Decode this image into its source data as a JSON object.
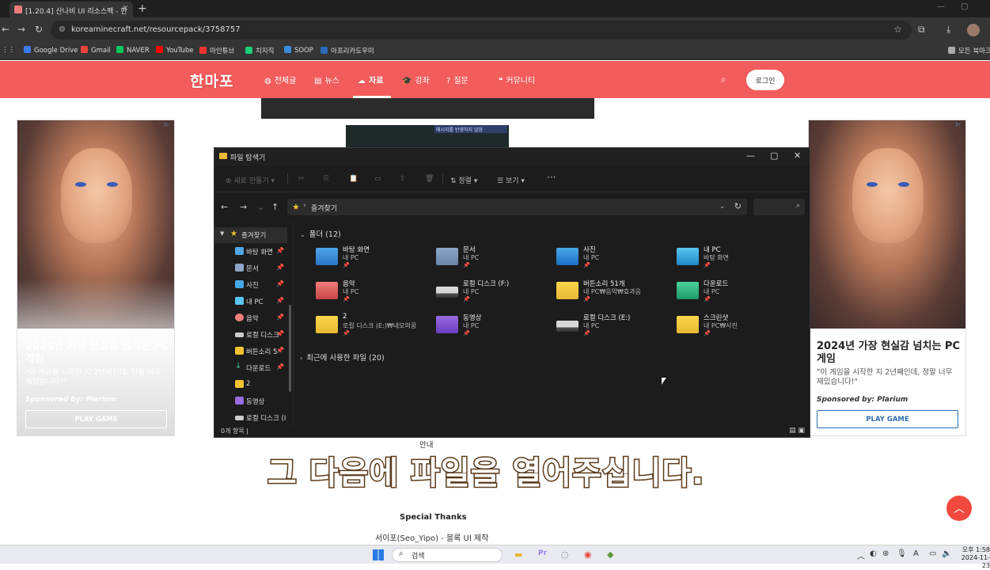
{
  "browser": {
    "tab_title": "[1.20.4] 산나비 UI 리소스팩 - 한",
    "url": "koreaminecraft.net/resourcepack/3758757",
    "bookmarks": [
      "Google Drive",
      "Gmail",
      "NAVER",
      "YouTube",
      "마인튜브",
      "치지직",
      "SOOP",
      "아프리카도우미"
    ],
    "bookmark_colors": [
      "#3b7ced",
      "#e8453c",
      "#03c75a",
      "#ff0000",
      "#e33",
      "#1fcf7a",
      "#3a8dde",
      "#2a6ab8"
    ],
    "all_bookmarks": "모든 북마크"
  },
  "site": {
    "logo": "한마포",
    "nav": [
      {
        "icon": "globe-icon",
        "label": "전체글"
      },
      {
        "icon": "news-icon",
        "label": "뉴스"
      },
      {
        "icon": "cloud-download-icon",
        "label": "자료"
      },
      {
        "icon": "graduation-cap-icon",
        "label": "강좌"
      },
      {
        "icon": "question-icon",
        "label": "질문"
      },
      {
        "icon": "chat-icon",
        "label": "커뮤니티"
      }
    ],
    "login_label": "로그인",
    "accent_color": "#f25c5c"
  },
  "content_tip": "메시지를 반영하지 않음",
  "ad": {
    "title": "2024년 가장 현실감 넘치는 PC 게임",
    "desc": "\"이 게임을 시작한 지 2년째인데, 정말 너무 재밌습니다!\"",
    "sponsor": "Sponsored by: Plarium",
    "button": "PLAY GAME"
  },
  "explorer": {
    "title": "파일 탐색기",
    "toolbar": {
      "new": "새로 만들기",
      "sort": "정렬",
      "view": "보기",
      "more": "···"
    },
    "path": "즐겨찾기",
    "sidebar": [
      {
        "label": "즐겨찾기",
        "color": "#f2c230"
      },
      {
        "label": "바탕 화면",
        "color": "#4fa6e8"
      },
      {
        "label": "문서",
        "color": "#8da6c8"
      },
      {
        "label": "사진",
        "color": "#47a8e8"
      },
      {
        "label": "내 PC",
        "color": "#59c5f0"
      },
      {
        "label": "음악",
        "color": "#f07c7c"
      },
      {
        "label": "로컬 디스크",
        "color": "#ccc"
      },
      {
        "label": "버튼소리 5",
        "color": "#f2c230"
      },
      {
        "label": "다운로드",
        "color": "#4ad09a"
      },
      {
        "label": "2",
        "color": "#f2c230"
      },
      {
        "label": "동영상",
        "color": "#9a6ae0"
      },
      {
        "label": "로컬 디스크 (I",
        "color": "#ccc"
      }
    ],
    "folders_header": "폴더 (12)",
    "recent_header": "최근에 사용한 파일 (20)",
    "folders": [
      {
        "name": "바탕 화면",
        "sub": "내 PC",
        "kind": "folder-blue"
      },
      {
        "name": "문서",
        "sub": "내 PC",
        "kind": "folder-doc"
      },
      {
        "name": "사진",
        "sub": "내 PC",
        "kind": "folder-pic"
      },
      {
        "name": "내 PC",
        "sub": "바탕 화면",
        "kind": "folder-pc"
      },
      {
        "name": "음악",
        "sub": "내 PC",
        "kind": "folder-music"
      },
      {
        "name": "로컬 디스크 (F:)",
        "sub": "내 PC",
        "kind": "drive"
      },
      {
        "name": "버튼소리 51개",
        "sub": "내 PC₩음악₩효과음",
        "kind": "folder-yellow"
      },
      {
        "name": "다운로드",
        "sub": "내 PC",
        "kind": "folder-dl"
      },
      {
        "name": "2",
        "sub": "로컬 디스크 (E:)₩네모의꿈",
        "kind": "folder-yellow"
      },
      {
        "name": "동영상",
        "sub": "내 PC",
        "kind": "folder-video"
      },
      {
        "name": "로컬 디스크 (E:)",
        "sub": "내 PC",
        "kind": "drive"
      },
      {
        "name": "스크린샷",
        "sub": "내 PC₩사진",
        "kind": "folder-yellow"
      }
    ],
    "status": "0개 항목 |"
  },
  "page": {
    "info_label": "안내",
    "caption": "그 다음에 파일을 열어주십니다.",
    "credits_title": "Special Thanks",
    "credits_line": "서이포(Seo_Yipo) - 블록 UI 제작"
  },
  "taskbar": {
    "search_label": "검색",
    "time": "오후 1:58",
    "date": "2024-11-23"
  }
}
